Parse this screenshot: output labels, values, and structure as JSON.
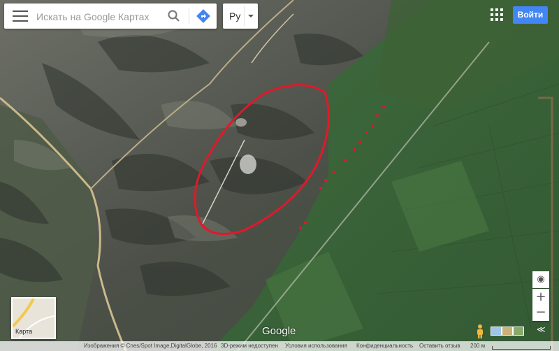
{
  "search": {
    "placeholder": "Искать на Google Картах"
  },
  "language": {
    "label": "Ру"
  },
  "header": {
    "signin_label": "Войти"
  },
  "zoom": {
    "in_label": "+",
    "out_label": "−",
    "expand_label": "≪"
  },
  "minimap": {
    "label": "Карта"
  },
  "map": {
    "logo": "Google",
    "annotation_color": "#e0192a"
  },
  "footer": {
    "imagery": "Изображения © Cnes/Spot Image,DigitalGlobe, 2016",
    "three_d": "3D-режим недоступен",
    "terms": "Условия использования",
    "privacy": "Конфиденциальность",
    "feedback": "Оставить отзыв",
    "scale": "200 м"
  },
  "icons": [
    "menu-icon",
    "search-icon",
    "directions-icon",
    "apps-grid-icon",
    "compass-icon",
    "pegman-icon"
  ],
  "colors": {
    "signin": "#4285f4",
    "directions": "#4285f4"
  }
}
